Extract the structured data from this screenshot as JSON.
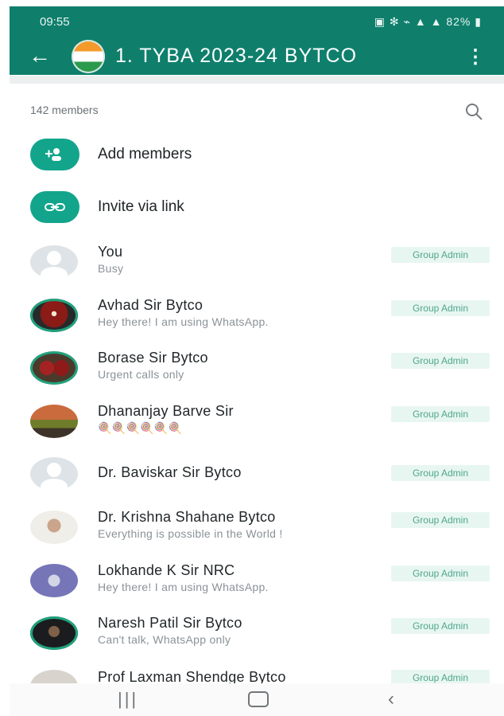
{
  "status_bar": {
    "time": "09:55",
    "right": "82%"
  },
  "header": {
    "title": "1. TYBA  2023-24 BYTCO",
    "back_icon": "arrow-left-icon",
    "menu_icon": "more-vert-icon"
  },
  "members": {
    "count": "142 members",
    "search_icon": "search-icon",
    "actions": [
      {
        "label": "Add members",
        "icon": "add-person-icon"
      },
      {
        "label": "Invite via link",
        "icon": "link-icon"
      }
    ],
    "list": [
      {
        "name": "You",
        "status": "Busy",
        "badge": "Group Admin",
        "avatar": "default"
      },
      {
        "name": "Avhad Sir Bytco",
        "status": "Hey there! I am using WhatsApp.",
        "badge": "Group Admin",
        "avatar": "photo"
      },
      {
        "name": "Borase Sir Bytco",
        "status": "Urgent calls only",
        "badge": "Group Admin",
        "avatar": "photo"
      },
      {
        "name": "Dhananjay Barve Sir",
        "status": "🍭🍭🍭🍭🍭🍭",
        "badge": "Group Admin",
        "avatar": "photo"
      },
      {
        "name": "Dr. Baviskar Sir Bytco",
        "status": "",
        "badge": "Group Admin",
        "avatar": "default"
      },
      {
        "name": "Dr. Krishna Shahane Bytco",
        "status": "Everything is possible in the World !",
        "badge": "Group Admin",
        "avatar": "photo"
      },
      {
        "name": "Lokhande K Sir NRC",
        "status": "Hey there! I am using WhatsApp.",
        "badge": "Group Admin",
        "avatar": "photo"
      },
      {
        "name": "Naresh Patil Sir Bytco",
        "status": "Can't talk, WhatsApp only",
        "badge": "Group Admin",
        "avatar": "photo"
      },
      {
        "name": "Prof Laxman Shendge Bytco",
        "status": "",
        "badge": "Group Admin",
        "avatar": "photo"
      }
    ]
  },
  "nav": {
    "recent_icon": "recent-apps-icon",
    "home_icon": "home-icon",
    "back_icon": "back-icon"
  },
  "colors": {
    "header": "#0f7f6c",
    "accent": "#12a58c",
    "badge_bg": "#e8f6f1",
    "badge_text": "#4ea68c"
  }
}
